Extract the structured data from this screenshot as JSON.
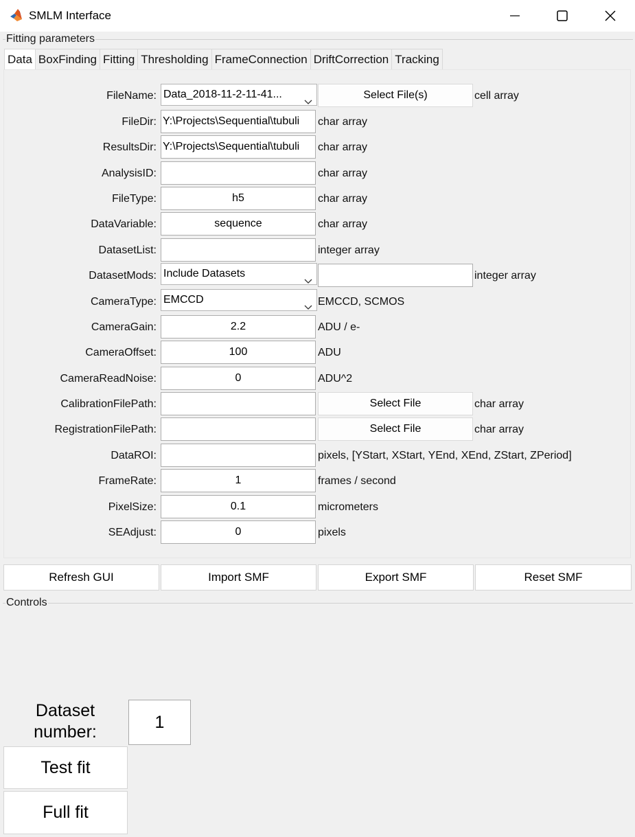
{
  "window": {
    "title": "SMLM Interface",
    "icon": "matlab-icon",
    "minimize_icon": "minimize-icon",
    "maximize_icon": "maximize-icon",
    "close_icon": "close-icon"
  },
  "fitting_panel": {
    "label": "Fitting parameters",
    "tabs": [
      "Data",
      "BoxFinding",
      "Fitting",
      "Thresholding",
      "FrameConnection",
      "DriftCorrection",
      "Tracking"
    ],
    "active_tab": "Data"
  },
  "rows": {
    "file_name": {
      "label": "FileName:",
      "value": "Data_2018-11-2-11-41...",
      "button": "Select File(s)",
      "type": "cell array"
    },
    "file_dir": {
      "label": "FileDir:",
      "value": "Y:\\Projects\\Sequential\\tubuli",
      "type": "char array"
    },
    "results_dir": {
      "label": "ResultsDir:",
      "value": "Y:\\Projects\\Sequential\\tubuli",
      "type": "char array"
    },
    "analysis_id": {
      "label": "AnalysisID:",
      "value": "",
      "type": "char array"
    },
    "file_type": {
      "label": "FileType:",
      "value": "h5",
      "type": "char array"
    },
    "data_variable": {
      "label": "DataVariable:",
      "value": "sequence",
      "type": "char array"
    },
    "dataset_list": {
      "label": "DatasetList:",
      "value": "",
      "type": "integer array"
    },
    "dataset_mods": {
      "label": "DatasetMods:",
      "value": "Include Datasets",
      "extra_value": "",
      "type": "integer array"
    },
    "camera_type": {
      "label": "CameraType:",
      "value": "EMCCD",
      "type": "EMCCD, SCMOS"
    },
    "camera_gain": {
      "label": "CameraGain:",
      "value": "2.2",
      "type": "ADU / e-"
    },
    "camera_offset": {
      "label": "CameraOffset:",
      "value": "100",
      "type": "ADU"
    },
    "camera_read_noise": {
      "label": "CameraReadNoise:",
      "value": "0",
      "type": "ADU^2"
    },
    "calibration_file_path": {
      "label": "CalibrationFilePath:",
      "value": "",
      "button": "Select File",
      "type": "char array"
    },
    "registration_file_path": {
      "label": "RegistrationFilePath:",
      "value": "",
      "button": "Select File",
      "type": "char array"
    },
    "data_roi": {
      "label": "DataROI:",
      "value": "",
      "type": "pixels, [YStart, XStart, YEnd, XEnd, ZStart, ZPeriod]"
    },
    "frame_rate": {
      "label": "FrameRate:",
      "value": "1",
      "type": "frames / second"
    },
    "pixel_size": {
      "label": "PixelSize:",
      "value": "0.1",
      "type": "micrometers"
    },
    "se_adjust": {
      "label": "SEAdjust:",
      "value": "0",
      "type": "pixels"
    }
  },
  "actions": {
    "refresh": "Refresh GUI",
    "import": "Import SMF",
    "export": "Export SMF",
    "reset": "Reset SMF"
  },
  "controls_panel": {
    "label": "Controls",
    "dataset_label": "Dataset number:",
    "dataset_value": "1",
    "test_fit": "Test fit",
    "full_fit": "Full fit"
  }
}
